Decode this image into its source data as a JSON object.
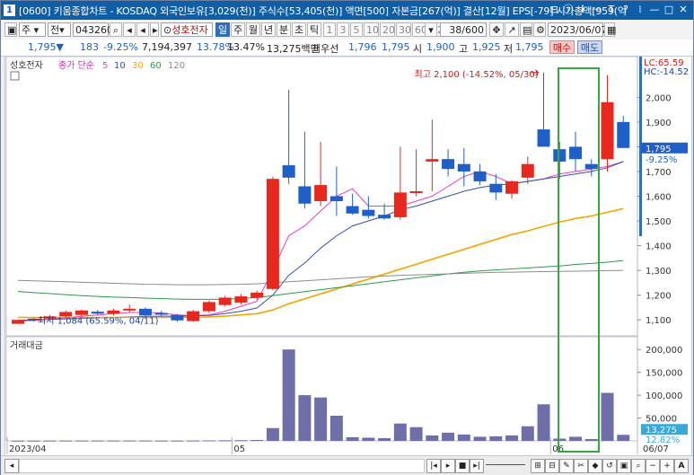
{
  "window": {
    "icon_label": "1",
    "title": "[0600] 키움종합차트 - KOSDAQ 외국인보유[3,029(천)] 주식수[53,405(천)] 액면[500] 자본금[267(억)] 결산[12월] EPS[-79] 시가총액[959(억",
    "buttons": [
      "⊟",
      "ⓘ",
      "ℹ",
      "ᅮ",
      "T",
      "?",
      "⁞",
      "—",
      "□",
      "✕"
    ]
  },
  "toolbar": {
    "period_select": "주",
    "type_select": "전",
    "code_input": "043260",
    "stock_name": "성호전자",
    "periods": [
      "일",
      "주",
      "월",
      "년",
      "분",
      "초",
      "틱"
    ],
    "active_period": "일",
    "minute_options": [
      "1",
      "3",
      "5",
      "10",
      "20",
      "30",
      "60",
      "120"
    ],
    "count_display": "38/600",
    "date": "2023/06/07"
  },
  "quote": {
    "price": "1,795",
    "change_arrow": "▼",
    "change": "183",
    "change_pct": "-9.25%",
    "volume": "7,194,397",
    "turnover_pct1": "13.78%",
    "turnover_pct2": "13.47%",
    "amount": "13,275백만",
    "bid_label": "최우선",
    "bid1": "1,796",
    "bid2": "1,795",
    "open_label": "시",
    "open": "1,900",
    "high_label": "고",
    "high": "1,925",
    "low_label": "저",
    "low": "1,795",
    "buy_label": "매수",
    "sell_label": "매도"
  },
  "legend": {
    "stock": "성호전자",
    "ma_label": "종가 단순",
    "ma_periods": [
      "5",
      "10",
      "30",
      "60",
      "120"
    ]
  },
  "annotations": {
    "high": "최고 2,100 (-14.52%, 05/30)",
    "low": "최저 1,084 (65.59%, 04/11)",
    "lc": "LC:65.59",
    "hc": "HC:-14.52",
    "price_tag": "1,795",
    "pct_tag": "-9.25%",
    "vol_tag": "13,275",
    "vol_pct_tag": "12.82%"
  },
  "colors": {
    "up": "#e8281e",
    "down": "#1e5fc8",
    "ma5": "#e63cc8",
    "ma10": "#3250b4",
    "ma30": "#f0a800",
    "ma60": "#2e9a4a",
    "ma120": "#8c8c8c",
    "volume": "#6e6ea8",
    "highlight": "#35a843"
  },
  "chart_data": [
    {
      "type": "candlestick",
      "name": "성호전자",
      "ylim": [
        1050,
        2150
      ],
      "yticks": [
        1100,
        1200,
        1300,
        1400,
        1500,
        1600,
        1700,
        1800,
        1900,
        2000
      ],
      "x_labels": [
        "2023/04",
        "05",
        "06"
      ],
      "x_label_index": [
        0,
        14,
        34
      ],
      "candles": [
        {
          "o": 1084,
          "h": 1100,
          "l": 1084,
          "c": 1100
        },
        {
          "o": 1100,
          "h": 1108,
          "l": 1092,
          "c": 1105
        },
        {
          "o": 1105,
          "h": 1120,
          "l": 1098,
          "c": 1114
        },
        {
          "o": 1114,
          "h": 1138,
          "l": 1108,
          "c": 1132
        },
        {
          "o": 1120,
          "h": 1142,
          "l": 1112,
          "c": 1138
        },
        {
          "o": 1133,
          "h": 1140,
          "l": 1122,
          "c": 1125
        },
        {
          "o": 1125,
          "h": 1145,
          "l": 1118,
          "c": 1138
        },
        {
          "o": 1138,
          "h": 1162,
          "l": 1130,
          "c": 1145
        },
        {
          "o": 1145,
          "h": 1150,
          "l": 1110,
          "c": 1118
        },
        {
          "o": 1128,
          "h": 1136,
          "l": 1115,
          "c": 1122
        },
        {
          "o": 1120,
          "h": 1124,
          "l": 1092,
          "c": 1098
        },
        {
          "o": 1095,
          "h": 1140,
          "l": 1092,
          "c": 1135
        },
        {
          "o": 1135,
          "h": 1178,
          "l": 1128,
          "c": 1172
        },
        {
          "o": 1160,
          "h": 1198,
          "l": 1155,
          "c": 1190
        },
        {
          "o": 1170,
          "h": 1205,
          "l": 1162,
          "c": 1195
        },
        {
          "o": 1190,
          "h": 1218,
          "l": 1182,
          "c": 1210
        },
        {
          "o": 1225,
          "h": 1680,
          "l": 1220,
          "c": 1670
        },
        {
          "o": 1725,
          "h": 2030,
          "l": 1650,
          "c": 1675
        },
        {
          "o": 1640,
          "h": 1860,
          "l": 1550,
          "c": 1570
        },
        {
          "o": 1580,
          "h": 1820,
          "l": 1560,
          "c": 1645
        },
        {
          "o": 1600,
          "h": 1720,
          "l": 1520,
          "c": 1580
        },
        {
          "o": 1560,
          "h": 1610,
          "l": 1525,
          "c": 1530
        },
        {
          "o": 1545,
          "h": 1600,
          "l": 1510,
          "c": 1520
        },
        {
          "o": 1525,
          "h": 1570,
          "l": 1505,
          "c": 1510
        },
        {
          "o": 1515,
          "h": 1800,
          "l": 1505,
          "c": 1615
        },
        {
          "o": 1615,
          "h": 1790,
          "l": 1600,
          "c": 1620
        },
        {
          "o": 1740,
          "h": 1910,
          "l": 1620,
          "c": 1750
        },
        {
          "o": 1750,
          "h": 1790,
          "l": 1680,
          "c": 1710
        },
        {
          "o": 1730,
          "h": 1795,
          "l": 1640,
          "c": 1700
        },
        {
          "o": 1700,
          "h": 1730,
          "l": 1645,
          "c": 1660
        },
        {
          "o": 1650,
          "h": 1690,
          "l": 1585,
          "c": 1615
        },
        {
          "o": 1610,
          "h": 1665,
          "l": 1590,
          "c": 1660
        },
        {
          "o": 1675,
          "h": 1760,
          "l": 1650,
          "c": 1730
        },
        {
          "o": 1870,
          "h": 2100,
          "l": 1800,
          "c": 1800
        },
        {
          "o": 1790,
          "h": 1820,
          "l": 1670,
          "c": 1740
        },
        {
          "o": 1800,
          "h": 1860,
          "l": 1700,
          "c": 1750
        },
        {
          "o": 1730,
          "h": 1750,
          "l": 1680,
          "c": 1710
        },
        {
          "o": 1750,
          "h": 2090,
          "l": 1700,
          "c": 1980
        },
        {
          "o": 1900,
          "h": 1925,
          "l": 1795,
          "c": 1795
        }
      ],
      "ma": [
        {
          "name": "5",
          "color": "#e63cc8",
          "values": [
            1095,
            1098,
            1102,
            1108,
            1115,
            1120,
            1125,
            1130,
            1130,
            1128,
            1120,
            1117,
            1120,
            1135,
            1155,
            1175,
            1300,
            1440,
            1480,
            1540,
            1600,
            1630,
            1560,
            1560,
            1560,
            1580,
            1600,
            1640,
            1680,
            1700,
            1680,
            1650,
            1660,
            1670,
            1690,
            1700,
            1710,
            1720,
            1740
          ]
        },
        {
          "name": "10",
          "color": "#3250b4",
          "values": [
            1098,
            1100,
            1102,
            1104,
            1106,
            1108,
            1110,
            1112,
            1114,
            1115,
            1115,
            1116,
            1118,
            1125,
            1135,
            1148,
            1200,
            1280,
            1330,
            1390,
            1440,
            1480,
            1500,
            1520,
            1545,
            1560,
            1580,
            1600,
            1620,
            1635,
            1645,
            1650,
            1660,
            1670,
            1680,
            1690,
            1700,
            1715,
            1740
          ]
        },
        {
          "name": "30",
          "color": "#f0a800",
          "values": [
            1110,
            1110,
            1110,
            1110,
            1110,
            1110,
            1110,
            1110,
            1110,
            1110,
            1110,
            1110,
            1112,
            1115,
            1120,
            1125,
            1140,
            1165,
            1185,
            1205,
            1225,
            1245,
            1265,
            1285,
            1305,
            1325,
            1345,
            1365,
            1385,
            1405,
            1425,
            1445,
            1460,
            1478,
            1495,
            1510,
            1520,
            1535,
            1550
          ]
        },
        {
          "name": "60",
          "color": "#2e9a4a",
          "values": [
            1215,
            1210,
            1206,
            1202,
            1198,
            1195,
            1192,
            1190,
            1188,
            1186,
            1184,
            1183,
            1183,
            1184,
            1186,
            1190,
            1198,
            1206,
            1214,
            1222,
            1230,
            1238,
            1246,
            1254,
            1262,
            1270,
            1278,
            1286,
            1292,
            1298,
            1302,
            1306,
            1310,
            1314,
            1318,
            1324,
            1328,
            1333,
            1340
          ]
        },
        {
          "name": "120",
          "color": "#8c8c8c",
          "values": [
            1260,
            1258,
            1256,
            1254,
            1252,
            1250,
            1248,
            1246,
            1244,
            1243,
            1242,
            1242,
            1242,
            1243,
            1244,
            1246,
            1250,
            1254,
            1258,
            1262,
            1266,
            1270,
            1274,
            1277,
            1280,
            1282,
            1284,
            1286,
            1288,
            1290,
            1292,
            1293,
            1294,
            1295,
            1296,
            1297,
            1298,
            1299,
            1300
          ]
        }
      ]
    },
    {
      "type": "bar",
      "name": "거래대금",
      "ylim": [
        0,
        220000
      ],
      "yticks": [
        50000,
        100000,
        150000,
        200000
      ],
      "ytick_labels": [
        "50,000",
        "100,000",
        "150,000",
        "200,000"
      ],
      "values": [
        500,
        500,
        600,
        700,
        700,
        700,
        700,
        800,
        700,
        600,
        600,
        700,
        1000,
        1200,
        1500,
        2000,
        28000,
        200000,
        100000,
        95000,
        55000,
        8000,
        7000,
        6000,
        38000,
        30000,
        12000,
        18000,
        14000,
        9000,
        10000,
        12000,
        32000,
        80000,
        5000,
        9000,
        4000,
        105000,
        13275
      ]
    }
  ]
}
